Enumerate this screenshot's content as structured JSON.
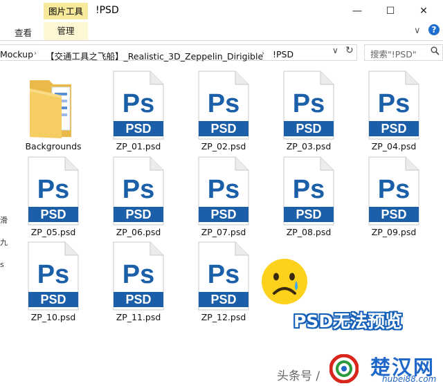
{
  "titlebar": {
    "context_tab": "图片工具",
    "title": "!PSD",
    "minimize": "—",
    "maximize": "☐",
    "close": "✕"
  },
  "ribbon": {
    "tabs": [
      "查看",
      "管理"
    ],
    "collapse": "∨",
    "help": "?"
  },
  "address": {
    "breadcrumbs": [
      "Mockup",
      "【交通工具之飞船】_Realistic_3D_Zeppelin_Dirigible",
      "!PSD"
    ],
    "separator": "›",
    "dropdown": "∨",
    "refresh": "↻",
    "search_placeholder": "搜索\"!PSD\""
  },
  "sidebar_fragments": [
    "滑",
    "九",
    "s"
  ],
  "files": [
    {
      "name": "Backgrounds",
      "type": "folder"
    },
    {
      "name": "ZP_01.psd",
      "type": "psd"
    },
    {
      "name": "ZP_02.psd",
      "type": "psd"
    },
    {
      "name": "ZP_03.psd",
      "type": "psd"
    },
    {
      "name": "ZP_04.psd",
      "type": "psd"
    },
    {
      "name": "ZP_05.psd",
      "type": "psd"
    },
    {
      "name": "ZP_06.psd",
      "type": "psd"
    },
    {
      "name": "ZP_07.psd",
      "type": "psd"
    },
    {
      "name": "ZP_08.psd",
      "type": "psd"
    },
    {
      "name": "ZP_09.psd",
      "type": "psd"
    },
    {
      "name": "ZP_10.psd",
      "type": "psd"
    },
    {
      "name": "ZP_11.psd",
      "type": "psd"
    },
    {
      "name": "ZP_12.psd",
      "type": "psd"
    }
  ],
  "psd_icon": {
    "logo": "Ps",
    "badge": "PSD",
    "color": "#1a5fa8"
  },
  "overlay": {
    "caption": "PSD无法预览",
    "toutiao": "头条号 /",
    "watermark_name": "楚汉网",
    "watermark_url": "hubei88.com"
  }
}
